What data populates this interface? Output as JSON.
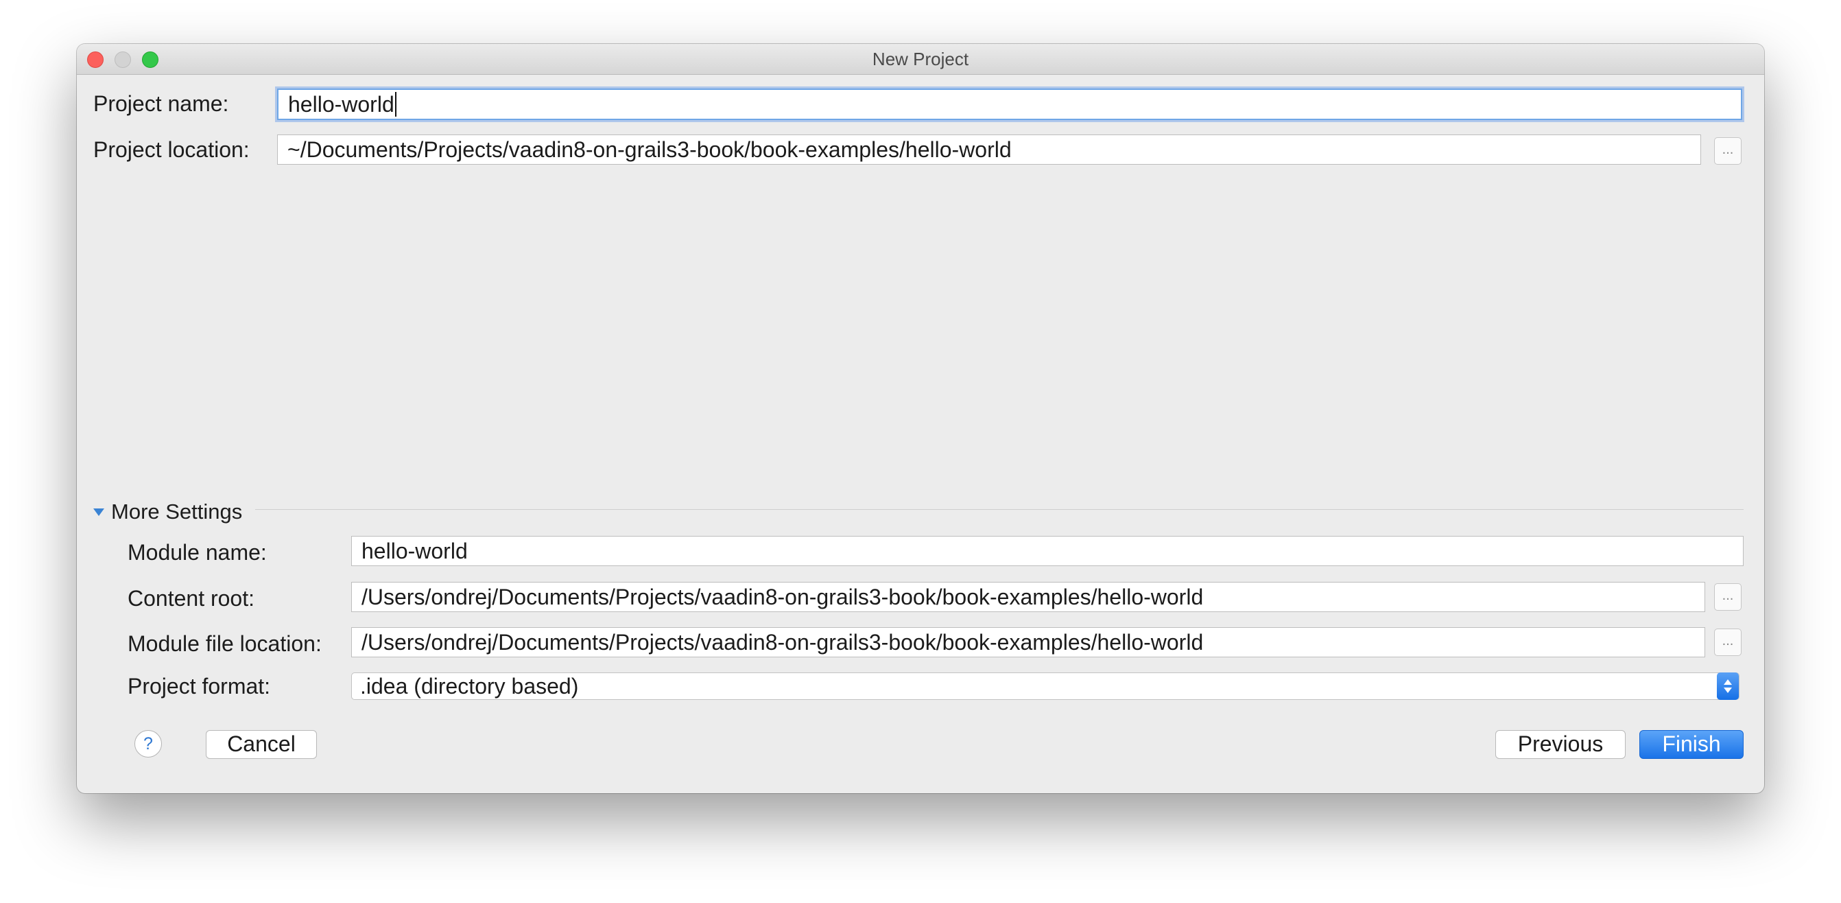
{
  "window": {
    "title": "New Project"
  },
  "project": {
    "name_label": "Project name:",
    "name_value": "hello-world",
    "location_label": "Project location:",
    "location_value": "~/Documents/Projects/vaadin8-on-grails3-book/book-examples/hello-world",
    "browse_label": "..."
  },
  "more_settings": {
    "title": "More Settings",
    "expanded": true,
    "module_name_label": "Module name:",
    "module_name_value": "hello-world",
    "content_root_label": "Content root:",
    "content_root_value": "/Users/ondrej/Documents/Projects/vaadin8-on-grails3-book/book-examples/hello-world",
    "module_file_label": "Module file location:",
    "module_file_value": "/Users/ondrej/Documents/Projects/vaadin8-on-grails3-book/book-examples/hello-world",
    "format_label": "Project format:",
    "format_value": ".idea (directory based)",
    "browse_label": "..."
  },
  "footer": {
    "help_label": "?",
    "cancel_label": "Cancel",
    "previous_label": "Previous",
    "finish_label": "Finish"
  },
  "colors": {
    "accent": "#1a73e8",
    "focus_ring": "#6fa6e6",
    "close": "#fc605c",
    "maximize": "#34c84a",
    "window_bg": "#ececec"
  }
}
